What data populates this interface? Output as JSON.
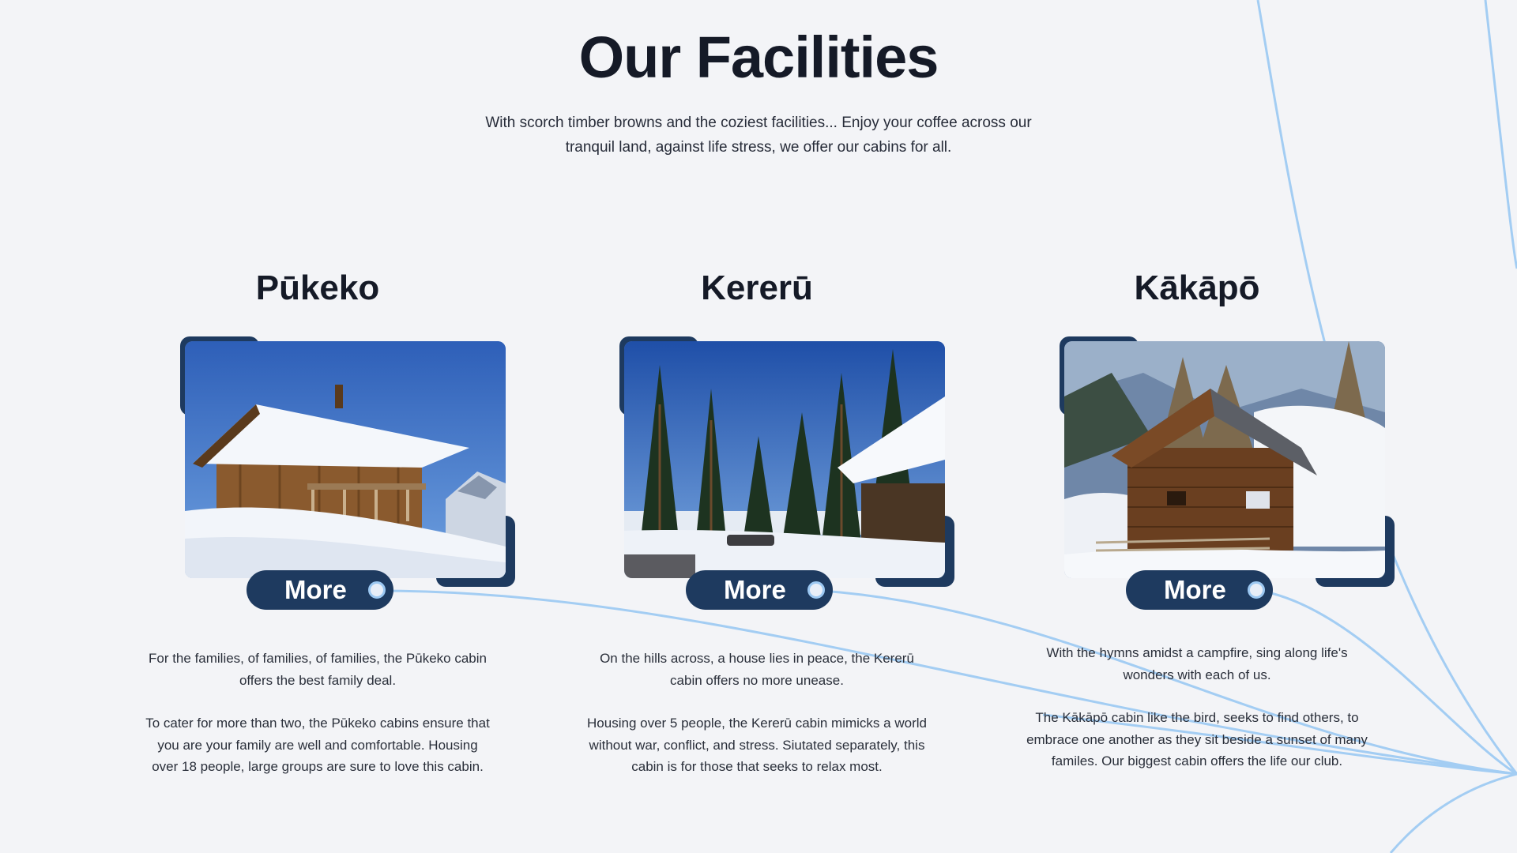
{
  "section": {
    "title": "Our Facilities",
    "subtitle": "With scorch timber browns and the coziest facilities... Enjoy your coffee across our tranquil land, against life stress, we offer our cabins for all."
  },
  "cabins": [
    {
      "name": "Pūkeko",
      "more_label": "More",
      "paragraph1": "For the families, of families, of families, the Pūkeko cabin offers the best family deal.",
      "paragraph2": "To cater for more than two, the Pūkeko cabins ensure that you are your family are well and comfortable. Housing over 18 people, large groups are sure to love this cabin."
    },
    {
      "name": "Kererū",
      "more_label": "More",
      "paragraph1": "On the hills across, a house lies in peace, the Kererū cabin offers no more unease.",
      "paragraph2": "Housing over 5 people, the Kererū cabin mimicks a world without war, conflict, and stress. Siutated separately, this cabin is for those that seeks to relax most."
    },
    {
      "name": "Kākāpō",
      "more_label": "More",
      "paragraph1": "With the hymns amidst a campfire, sing along life's wonders with each of us.",
      "paragraph2": "The Kākāpō cabin like the bird, seeks to find others, to embrace one another as they sit beside a sunset of many familes. Our biggest cabin offers the life our club."
    }
  ],
  "colors": {
    "background": "#f3f4f7",
    "accent_navy": "#1e3a5f",
    "decorative_line": "#9cc8f2",
    "heading": "#151a27"
  }
}
